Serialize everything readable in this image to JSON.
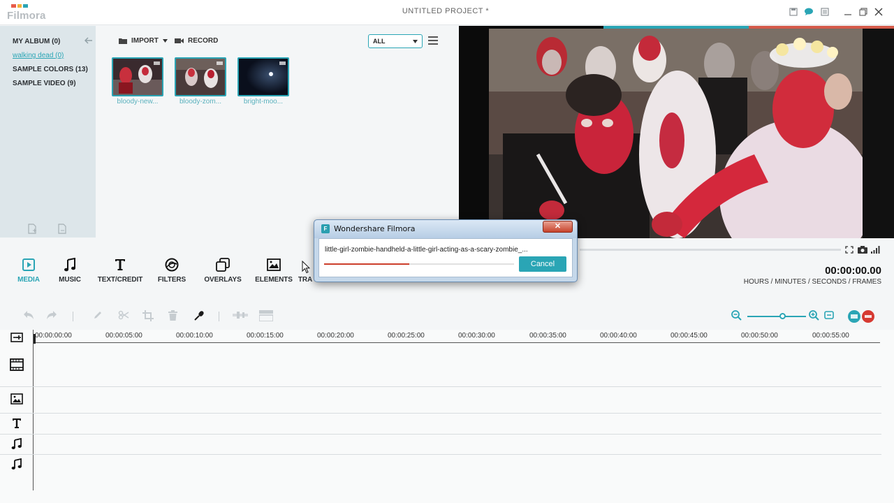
{
  "app": {
    "logo_text": "Filmora",
    "project_title": "UNTITLED PROJECT *",
    "logo_colors": [
      "#e85c4a",
      "#f3b13a",
      "#2aa5b5"
    ]
  },
  "albums": {
    "items": [
      {
        "label": "MY ALBUM (0)",
        "active": false
      },
      {
        "label": "walking dead (0)",
        "active": true
      },
      {
        "label": "SAMPLE COLORS (13)",
        "active": false
      },
      {
        "label": "SAMPLE VIDEO (9)",
        "active": false
      }
    ]
  },
  "media": {
    "import_label": "IMPORT",
    "record_label": "RECORD",
    "filter_value": "ALL",
    "thumbnails": [
      {
        "caption": "bloody-new..."
      },
      {
        "caption": "bloody-zom..."
      },
      {
        "caption": "bright-moo..."
      }
    ]
  },
  "preview": {
    "timecode": "00:00:00.00",
    "timecode_label": "HOURS / MINUTES / SECONDS / FRAMES"
  },
  "tabs": [
    {
      "label": "MEDIA",
      "icon": "media-icon",
      "active": true
    },
    {
      "label": "MUSIC",
      "icon": "music-icon",
      "active": false
    },
    {
      "label": "TEXT/CREDIT",
      "icon": "text-icon",
      "active": false
    },
    {
      "label": "FILTERS",
      "icon": "filters-icon",
      "active": false
    },
    {
      "label": "OVERLAYS",
      "icon": "overlays-icon",
      "active": false
    },
    {
      "label": "ELEMENTS",
      "icon": "elements-icon",
      "active": false
    },
    {
      "label": "TRA",
      "icon": "transitions-icon",
      "active": false
    }
  ],
  "timeline": {
    "ticks": [
      "00:00:00:00",
      "00:00:05:00",
      "00:00:10:00",
      "00:00:15:00",
      "00:00:20:00",
      "00:00:25:00",
      "00:00:30:00",
      "00:00:35:00",
      "00:00:40:00",
      "00:00:45:00",
      "00:00:50:00",
      "00:00:55:00"
    ]
  },
  "dialog": {
    "title": "Wondershare Filmora",
    "close_label": "✕",
    "filename": "little-girl-zombie-handheld-a-little-girl-acting-as-a-scary-zombie_...",
    "progress": 0.45,
    "cancel_label": "Cancel"
  },
  "colors": {
    "accent": "#2aa5b5",
    "progress_red": "#cc3f2b"
  }
}
